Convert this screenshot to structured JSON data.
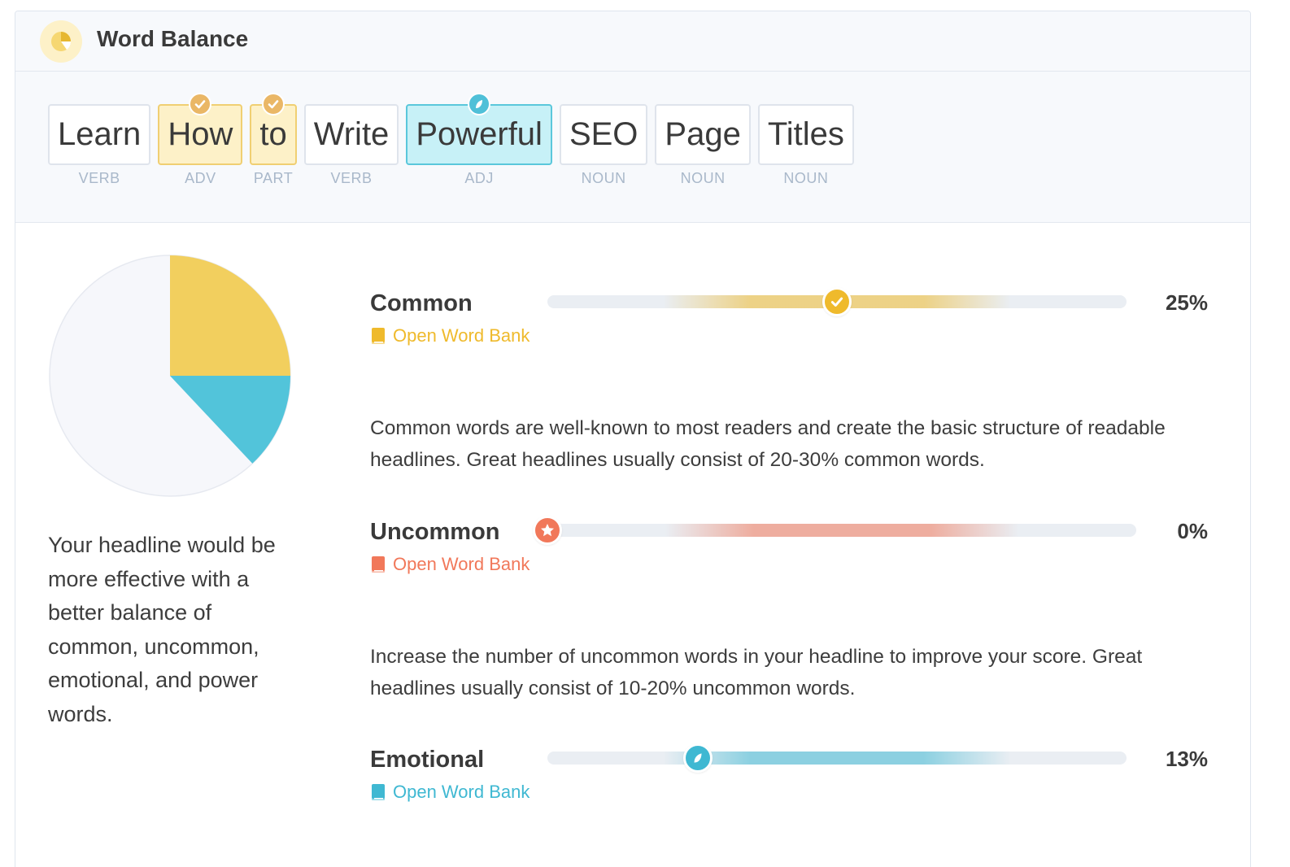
{
  "header": {
    "title": "Word Balance",
    "icon": "pie-chart-icon"
  },
  "words": [
    {
      "text": "Learn",
      "pos": "VERB",
      "category": "none"
    },
    {
      "text": "How",
      "pos": "ADV",
      "category": "common"
    },
    {
      "text": "to",
      "pos": "PART",
      "category": "common"
    },
    {
      "text": "Write",
      "pos": "VERB",
      "category": "none"
    },
    {
      "text": "Powerful",
      "pos": "ADJ",
      "category": "emotional"
    },
    {
      "text": "SEO",
      "pos": "NOUN",
      "category": "none"
    },
    {
      "text": "Page",
      "pos": "NOUN",
      "category": "none"
    },
    {
      "text": "Titles",
      "pos": "NOUN",
      "category": "none"
    }
  ],
  "pie": {
    "slices": [
      {
        "name": "Common",
        "value": 25,
        "color": "#f2cf5e"
      },
      {
        "name": "Emotional",
        "value": 13,
        "color": "#52c4da"
      }
    ],
    "background_color": "#f6f7fb"
  },
  "summary": "Your headline would be more effective with a better balance of common, uncommon, emotional, and power words.",
  "metrics": {
    "common": {
      "name": "Common",
      "value_label": "25%",
      "value": 25,
      "bank_label": "Open Word Bank",
      "color": "#efba2c",
      "description": "Common words are well-known to most readers and create the basic structure of readable headlines. Great headlines usually consist of 20-30% common words."
    },
    "uncommon": {
      "name": "Uncommon",
      "value_label": "0%",
      "value": 0,
      "bank_label": "Open Word Bank",
      "color": "#f1785a",
      "description": "Increase the number of uncommon words in your headline to improve your score. Great headlines usually consist of 10-20% uncommon words."
    },
    "emotional": {
      "name": "Emotional",
      "value_label": "13%",
      "value": 13,
      "bank_label": "Open Word Bank",
      "color": "#3fb8d2"
    }
  }
}
